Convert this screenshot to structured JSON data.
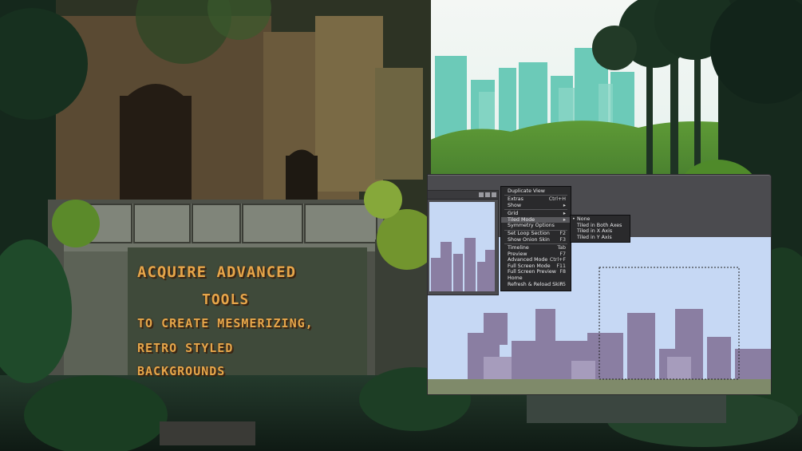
{
  "headline": {
    "lines": [
      "ACQUIRE ADVANCED",
      "TOOLS",
      "TO CREATE MESMERIZING,",
      "RETRO STYLED",
      "BACKGROUNDS"
    ]
  },
  "context_menu": {
    "items": [
      {
        "label": "Duplicate View",
        "shortcut": ""
      },
      {
        "label": "Extras",
        "shortcut": "Ctrl+H"
      },
      {
        "label": "Show",
        "shortcut": "▸"
      },
      {
        "label": "Grid",
        "shortcut": "▸"
      },
      {
        "label": "Tiled Mode",
        "shortcut": "▸"
      },
      {
        "label": "Symmetry Options",
        "shortcut": ""
      },
      {
        "label": "Set Loop Section",
        "shortcut": "F2"
      },
      {
        "label": "Show Onion Skin",
        "shortcut": "F3"
      },
      {
        "label": "Timeline",
        "shortcut": "Tab"
      },
      {
        "label": "Preview",
        "shortcut": "F7"
      },
      {
        "label": "Advanced Mode",
        "shortcut": "Ctrl+F"
      },
      {
        "label": "Full Screen Mode",
        "shortcut": "F11"
      },
      {
        "label": "Full Screen Preview",
        "shortcut": "F8"
      },
      {
        "label": "Home",
        "shortcut": ""
      },
      {
        "label": "Refresh & Reload Skin",
        "shortcut": "F5"
      }
    ]
  },
  "tiled_submenu": {
    "items": [
      {
        "label": "None",
        "active": true
      },
      {
        "label": "Tiled in Both Axes",
        "active": false
      },
      {
        "label": "Tiled in X Axis",
        "active": false
      },
      {
        "label": "Tiled in Y Axis",
        "active": false
      }
    ]
  },
  "colors": {
    "sky": "#e6f1f0",
    "city_far": "#5bc3b2",
    "jungle_dark": "#17301f",
    "stone": "#6a7062",
    "headline": "#e6a64a",
    "editor_bg": "#4b4b4f",
    "canvas_sky": "#c6d8f4",
    "canvas_city": "#8a7ea2"
  }
}
